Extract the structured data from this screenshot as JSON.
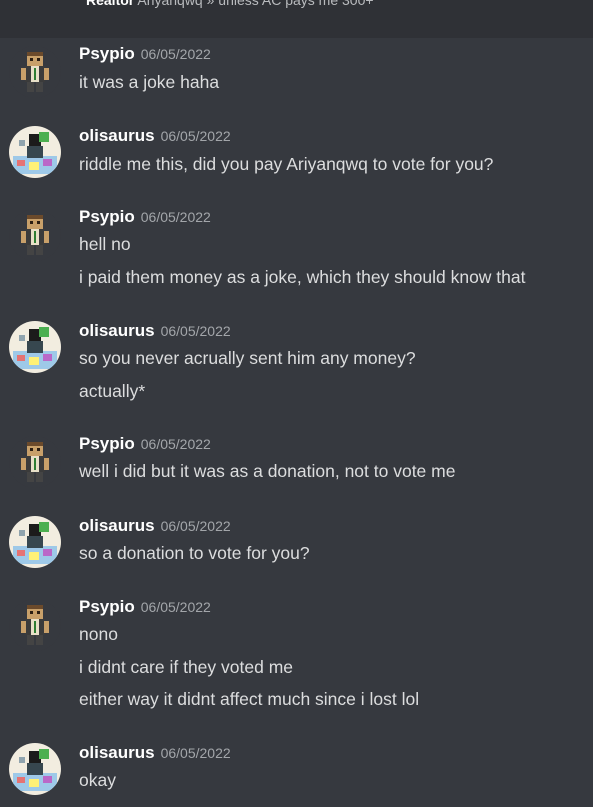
{
  "topbar": {
    "reply_author": "Realtor",
    "reply_text": " Ariyanqwq » unless AC pays me 300+"
  },
  "messages": [
    {
      "author": "Psypio",
      "timestamp": "06/05/2022",
      "avatar": "psypio-skin-avatar",
      "lines": [
        "it was a joke haha"
      ]
    },
    {
      "author": "olisaurus",
      "timestamp": "06/05/2022",
      "avatar": "olisaurus-round-avatar",
      "lines": [
        "riddle me this, did you pay Ariyanqwq to vote for you?"
      ]
    },
    {
      "author": "Psypio",
      "timestamp": "06/05/2022",
      "avatar": "psypio-skin-avatar",
      "lines": [
        "hell no",
        "i paid them money as a joke, which they should know that"
      ]
    },
    {
      "author": "olisaurus",
      "timestamp": "06/05/2022",
      "avatar": "olisaurus-round-avatar",
      "lines": [
        "so you never acrually sent him any money?",
        "actually*"
      ]
    },
    {
      "author": "Psypio",
      "timestamp": "06/05/2022",
      "avatar": "psypio-skin-avatar",
      "lines": [
        "well i did but it was as a donation, not to vote me"
      ]
    },
    {
      "author": "olisaurus",
      "timestamp": "06/05/2022",
      "avatar": "olisaurus-round-avatar",
      "lines": [
        "so a donation to vote for you?"
      ]
    },
    {
      "author": "Psypio",
      "timestamp": "06/05/2022",
      "avatar": "psypio-skin-avatar",
      "lines": [
        "nono",
        "i didnt care if they voted me",
        "either way it didnt affect much since i lost lol"
      ]
    },
    {
      "author": "olisaurus",
      "timestamp": "06/05/2022",
      "avatar": "olisaurus-round-avatar",
      "lines": [
        "okay"
      ]
    }
  ]
}
